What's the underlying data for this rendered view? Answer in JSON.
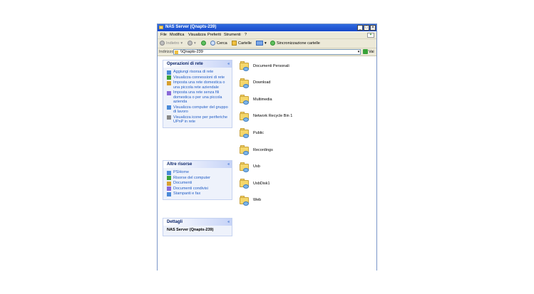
{
  "window": {
    "title": "NAS Server (Qnapts-239)",
    "controls": {
      "minimize": "_",
      "maximize": "□",
      "close": "×"
    }
  },
  "menu": {
    "items": [
      "File",
      "Modifica",
      "Visualizza",
      "Preferiti",
      "Strumenti",
      "?"
    ]
  },
  "toolbar": {
    "back": "Indietro",
    "search": "Cerca",
    "folders": "Cartelle",
    "sync": "Sincronizzazione cartelle"
  },
  "address": {
    "label": "Indirizzo",
    "value": "\\\\Qnapts-239",
    "go": "Vai"
  },
  "tasks": {
    "network": {
      "header": "Operazioni di rete",
      "items": [
        {
          "label": "Aggiungi risorsa di rete",
          "icon": "add-network-place-icon"
        },
        {
          "label": "Visualizza connessioni di rete",
          "icon": "network-connections-icon"
        },
        {
          "label": "Imposta una rete domestica o una piccola rete aziendale",
          "icon": "home-network-icon"
        },
        {
          "label": "Imposta una rete senza fili domestica o per una piccola azienda",
          "icon": "wireless-network-icon"
        },
        {
          "label": "Visualizza computer del gruppo di lavoro",
          "icon": "workgroup-computers-icon"
        },
        {
          "label": "Visualizza icone per periferiche UPnP in rete",
          "icon": "upnp-devices-icon"
        }
      ]
    },
    "other": {
      "header": "Altre risorse",
      "items": [
        {
          "label": "PSHome",
          "icon": "network-share-icon"
        },
        {
          "label": "Risorse del computer",
          "icon": "my-computer-icon"
        },
        {
          "label": "Documenti",
          "icon": "documents-icon"
        },
        {
          "label": "Documenti condivisi",
          "icon": "shared-documents-icon"
        },
        {
          "label": "Stampanti e fax",
          "icon": "printers-icon"
        }
      ]
    },
    "details": {
      "header": "Dettagli",
      "text": "NAS Server (Qnapts-239)"
    }
  },
  "folders": [
    "Documenti Personali",
    "Download",
    "Multimedia",
    "Network Recycle Bin 1",
    "Public",
    "Recordings",
    "Usb",
    "UsbDisk1",
    "Web"
  ],
  "colors": {
    "titlebar": "#1f56d2",
    "taskpane_text": "#215dc6",
    "folder": "#f5d76b"
  }
}
